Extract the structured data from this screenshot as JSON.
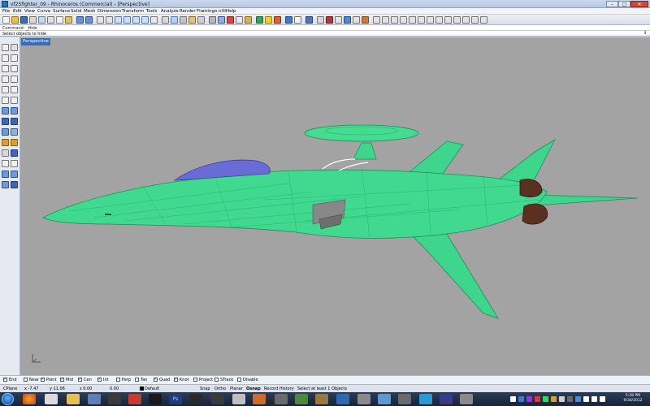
{
  "window": {
    "title": "vf25fighter_09 - Rhinoceros (Commercial) - [Perspective]",
    "buttons": {
      "minimize": "–",
      "maximize": "□",
      "close": "✕"
    }
  },
  "menubar": [
    "File",
    "Edit",
    "View",
    "Curve",
    "Surface",
    "Solid",
    "Mesh",
    "Dimension",
    "Transform",
    "Tools",
    "Analyze",
    "Render",
    "Flamingo nXt",
    "Help"
  ],
  "command_history": "Command: _Hide",
  "command_prompt": "Select objects to hide",
  "prompt_scroll_icon": "chevron-up-down",
  "viewport": {
    "tab_label": "Perspective",
    "background": "#a3a3a3",
    "model_color": "#3dd68c",
    "canopy_color": "#6a6cd6",
    "nozzle_color": "#5a3020"
  },
  "osnap": [
    {
      "label": "End",
      "checked": true
    },
    {
      "label": "Near",
      "checked": false
    },
    {
      "label": "Point",
      "checked": true
    },
    {
      "label": "Mid",
      "checked": true
    },
    {
      "label": "Cen",
      "checked": true
    },
    {
      "label": "Int",
      "checked": true
    },
    {
      "label": "Perp",
      "checked": false
    },
    {
      "label": "Tan",
      "checked": false
    },
    {
      "label": "Quad",
      "checked": true
    },
    {
      "label": "Knot",
      "checked": true
    },
    {
      "label": "Project",
      "checked": false
    },
    {
      "label": "STrack",
      "checked": false
    },
    {
      "label": "Disable",
      "checked": false
    }
  ],
  "status": {
    "cplane": "CPlane",
    "x": "x -7.47",
    "y": "y 11.06",
    "z": "z 0.00",
    "value": "0.00",
    "layer": "Default",
    "snap": "Snap",
    "ortho": "Ortho",
    "planar": "Planar",
    "osnap": "Osnap",
    "record_history": "Record History",
    "selection": "Select at least 1 Objects"
  },
  "taskbar": {
    "time": "5:28 PM",
    "date": "9/30/2012"
  }
}
